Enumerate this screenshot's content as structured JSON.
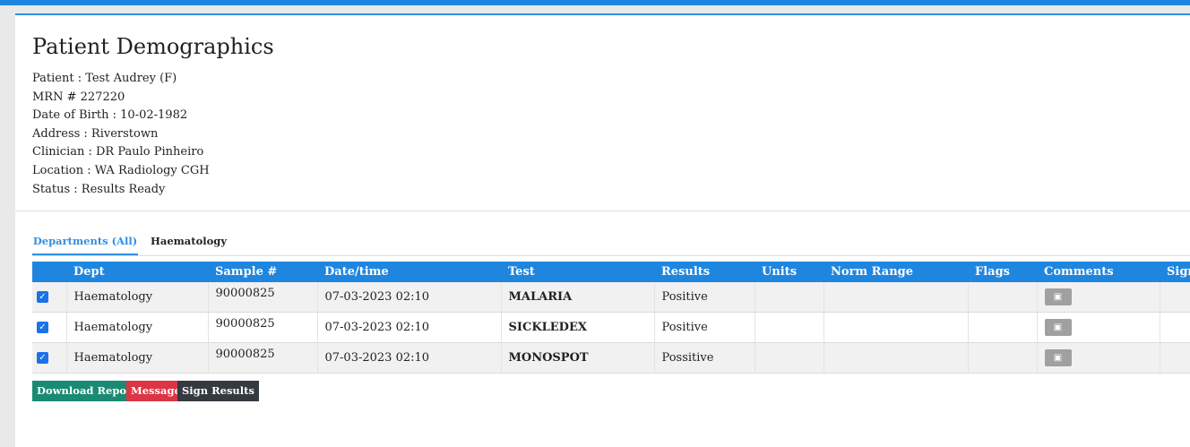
{
  "page": {
    "title": "Patient Demographics"
  },
  "patient": {
    "patient": "Patient : Test Audrey (F)",
    "mrn": "MRN # 227220",
    "dob": "Date of Birth : 10-02-1982",
    "address": "Address : Riverstown",
    "clinician": "Clinician : DR Paulo Pinheiro",
    "location": "Location : WA Radiology CGH",
    "status": "Status : Results Ready"
  },
  "tabs": {
    "active": "Departments (All)",
    "other": "Haematology"
  },
  "table": {
    "headers": [
      "Dept",
      "Sample #",
      "Date/time",
      "Test",
      "Results",
      "Units",
      "Norm Range",
      "Flags",
      "Comments",
      "Sign"
    ],
    "rows": [
      {
        "dept": "Haematology",
        "sample": "90000825",
        "datetime": "07-03-2023 02:10",
        "test": "MALARIA",
        "result": "Positive",
        "units": "",
        "norm_range": "",
        "flags": "",
        "checked": true
      },
      {
        "dept": "Haematology",
        "sample": "90000825",
        "datetime": "07-03-2023 02:10",
        "test": "SICKLEDEX",
        "result": "Positive",
        "units": "",
        "norm_range": "",
        "flags": "",
        "checked": true
      },
      {
        "dept": "Haematology",
        "sample": "90000825",
        "datetime": "07-03-2023 02:10",
        "test": "MONOSPOT",
        "result": "Possitive",
        "units": "",
        "norm_range": "",
        "flags": "",
        "checked": true
      }
    ]
  },
  "actions": {
    "download": "Download Report",
    "message": "Message",
    "sign": "Sign Results"
  },
  "colors": {
    "accent": "#1f86e0",
    "download": "#1a8a73",
    "message": "#dc3545",
    "sign": "#343a40"
  },
  "icons": {
    "checkbox": "checkmark-icon",
    "comment": "comment-icon"
  }
}
